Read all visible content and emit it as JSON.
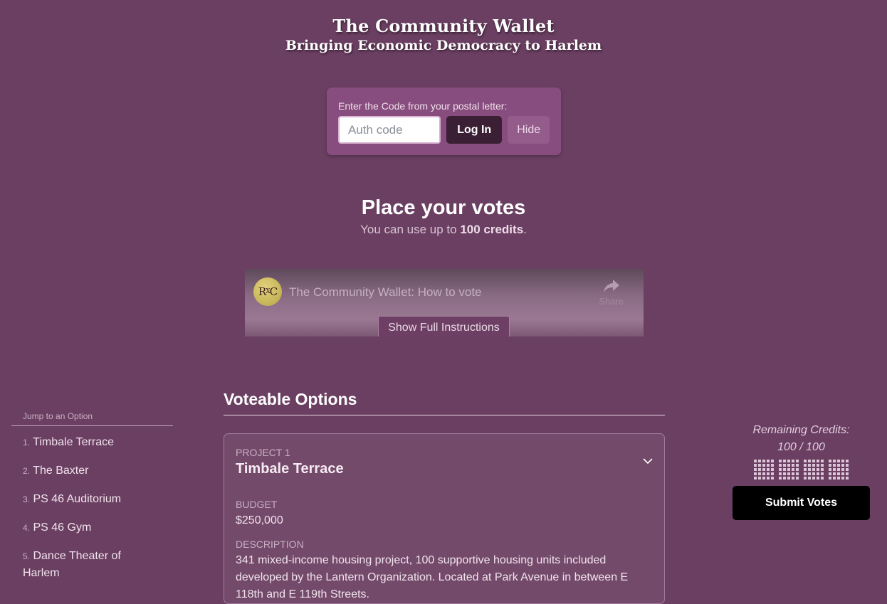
{
  "header": {
    "title": "The Community Wallet",
    "subtitle": "Bringing Economic Democracy to Harlem"
  },
  "login": {
    "label": "Enter the Code from your postal letter:",
    "input_placeholder": "Auth code",
    "input_value": "",
    "login_button": "Log In",
    "hide_button": "Hide"
  },
  "voting": {
    "heading": "Place your votes",
    "subtext_prefix": "You can use up to ",
    "subtext_bold": "100 credits",
    "subtext_suffix": "."
  },
  "video": {
    "channel_logo_text": "RXC",
    "title": "The Community Wallet: How to vote",
    "share_label": "Share",
    "share_icon": "share-arrow-icon",
    "instructions_button": "Show Full Instructions"
  },
  "sidebar": {
    "label": "Jump to an Option",
    "items": [
      {
        "num": "1.",
        "label": "Timbale Terrace"
      },
      {
        "num": "2.",
        "label": "The Baxter"
      },
      {
        "num": "3.",
        "label": "PS 46 Auditorium"
      },
      {
        "num": "4.",
        "label": "PS 46 Gym"
      },
      {
        "num": "5.",
        "label": "Dance Theater of Harlem"
      }
    ]
  },
  "main": {
    "heading": "Voteable Options",
    "projects": [
      {
        "number_label": "PROJECT 1",
        "name": "Timbale Terrace",
        "budget_label": "BUDGET",
        "budget": "$250,000",
        "description_label": "DESCRIPTION",
        "description": "341 mixed-income housing project, 100 supportive housing units included developed by the Lantern Organization. Located at Park Avenue in between E 118th and E 119th Streets."
      }
    ]
  },
  "credits": {
    "label": "Remaining Credits:",
    "value": "100 / 100",
    "remaining": 100,
    "total": 100,
    "submit_button": "Submit Votes"
  },
  "colors": {
    "background": "#6b3f62",
    "login_panel": "#874d7e",
    "login_button": "#3b1f35",
    "submit_button": "#000000"
  }
}
